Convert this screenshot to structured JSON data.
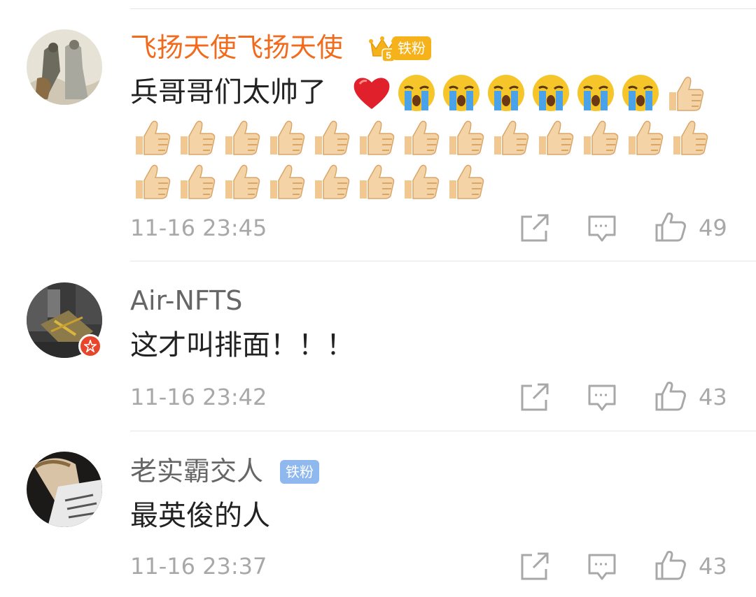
{
  "comments": [
    {
      "username": "飞扬天使飞扬天使",
      "fan_badge": "铁粉",
      "fan_level": "5",
      "text": "兵哥哥们太帅了",
      "emojis": [
        "heart-icon",
        "crying-face-icon",
        "crying-face-icon",
        "crying-face-icon",
        "crying-face-icon",
        "crying-face-icon",
        "crying-face-icon",
        "thumbs-up-icon",
        "thumbs-up-icon",
        "thumbs-up-icon",
        "thumbs-up-icon",
        "thumbs-up-icon",
        "thumbs-up-icon",
        "thumbs-up-icon",
        "thumbs-up-icon",
        "thumbs-up-icon",
        "thumbs-up-icon",
        "thumbs-up-icon",
        "thumbs-up-icon",
        "thumbs-up-icon",
        "thumbs-up-icon",
        "thumbs-up-icon",
        "thumbs-up-icon",
        "thumbs-up-icon",
        "thumbs-up-icon",
        "thumbs-up-icon",
        "thumbs-up-icon",
        "thumbs-up-icon",
        "thumbs-up-icon"
      ],
      "time": "11-16 23:45",
      "likes": "49"
    },
    {
      "username": "Air-NFTS",
      "text": "这才叫排面！！！",
      "time": "11-16 23:42",
      "likes": "43"
    },
    {
      "username": "老实霸交人",
      "fan_badge": "铁粉",
      "text": "最英俊的人",
      "time": "11-16 23:37",
      "likes": "43"
    }
  ],
  "colors": {
    "username_highlight": "#f26b1d",
    "meta_gray": "#a8a8a8",
    "fan_badge_gold": "#f6b21a",
    "fan_badge_blue": "#8fb8ee",
    "heart_red": "#e0202a"
  }
}
